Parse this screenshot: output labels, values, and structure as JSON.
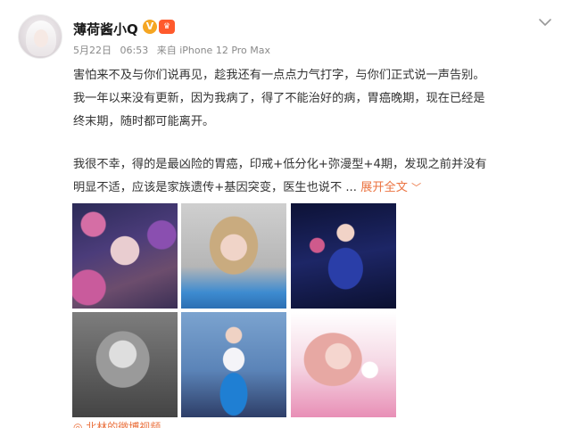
{
  "post": {
    "author": "薄荷酱小Q",
    "date": "5月22日",
    "time": "06:53",
    "source": "来自 iPhone 12 Pro Max",
    "lines": [
      "害怕来不及与你们说再见，趁我还有一点点力气打字，与你们正式说一声告别。",
      "我一年以来没有更新，因为我病了，得了不能治好的病，胃癌晚期，现在已经是",
      "终末期，随时都可能离开。",
      "我很不幸，得的是最凶险的胃癌，印戒+低分化+弥漫型+4期，发现之前并没有",
      "明显不适，应该是家族遗传+基因突变，医生也说不 ..."
    ],
    "expand_label": "展开全文",
    "bottom_cut_text": "◎ 北林的微博视频"
  },
  "colors": {
    "accent": "#eb7340",
    "verified": "#f5a623",
    "vip": "#ff5a2c"
  },
  "icons": {
    "verified": "verified-badge-icon",
    "vip": "vip-badge-icon",
    "more": "chevron-down-icon"
  }
}
